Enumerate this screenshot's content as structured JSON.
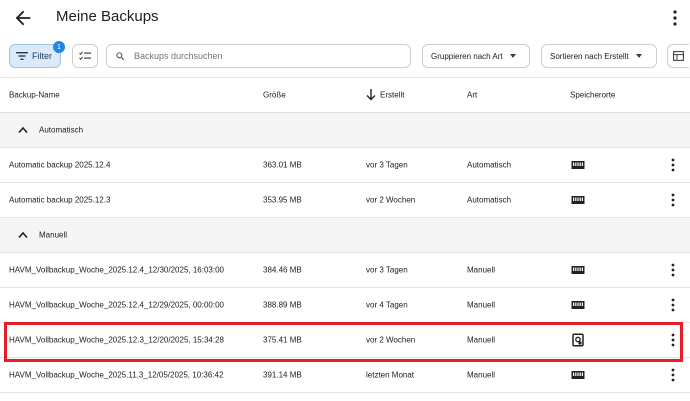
{
  "header": {
    "title": "Meine Backups"
  },
  "toolbar": {
    "filter_label": "Filter",
    "filter_count": "1",
    "search_placeholder": "Backups durchsuchen",
    "group_label": "Gruppieren nach Art",
    "sort_label": "Sortieren nach Erstellt"
  },
  "columns": {
    "name": "Backup-Name",
    "size": "Größe",
    "created": "Erstellt",
    "type": "Art",
    "locations": "Speicherorte"
  },
  "groups": [
    {
      "label": "Automatisch",
      "rows": [
        {
          "name": "Automatic backup 2025.12.4",
          "size": "363.01 MB",
          "created": "vor 3 Tagen",
          "type": "Automatisch",
          "location_icon": "nas-drive-icon"
        },
        {
          "name": "Automatic backup 2025.12.3",
          "size": "353.95 MB",
          "created": "vor 2 Wochen",
          "type": "Automatisch",
          "location_icon": "nas-drive-icon"
        }
      ]
    },
    {
      "label": "Manuell",
      "rows": [
        {
          "name": "HAVM_Vollbackup_Woche_2025.12.4_12/30/2025, 16:03:00",
          "size": "384.46 MB",
          "created": "vor 3 Tagen",
          "type": "Manuell",
          "location_icon": "nas-drive-icon"
        },
        {
          "name": "HAVM_Vollbackup_Woche_2025.12.4_12/29/2025, 00:00:00",
          "size": "388.89 MB",
          "created": "vor 4 Tagen",
          "type": "Manuell",
          "location_icon": "nas-drive-icon"
        },
        {
          "name": "HAVM_Vollbackup_Woche_2025.12.3_12/20/2025, 15:34:28",
          "size": "375.41 MB",
          "created": "vor 2 Wochen",
          "type": "Manuell",
          "location_icon": "local-storage-icon"
        },
        {
          "name": "HAVM_Vollbackup_Woche_2025.11.3_12/05/2025, 10:36:42",
          "size": "391.14 MB",
          "created": "letzten Monat",
          "type": "Manuell",
          "location_icon": "nas-drive-icon"
        }
      ]
    }
  ],
  "colors": {
    "accent": "#1e88e5",
    "highlight": "#e31e24",
    "group_bg": "#f5f5f5"
  }
}
